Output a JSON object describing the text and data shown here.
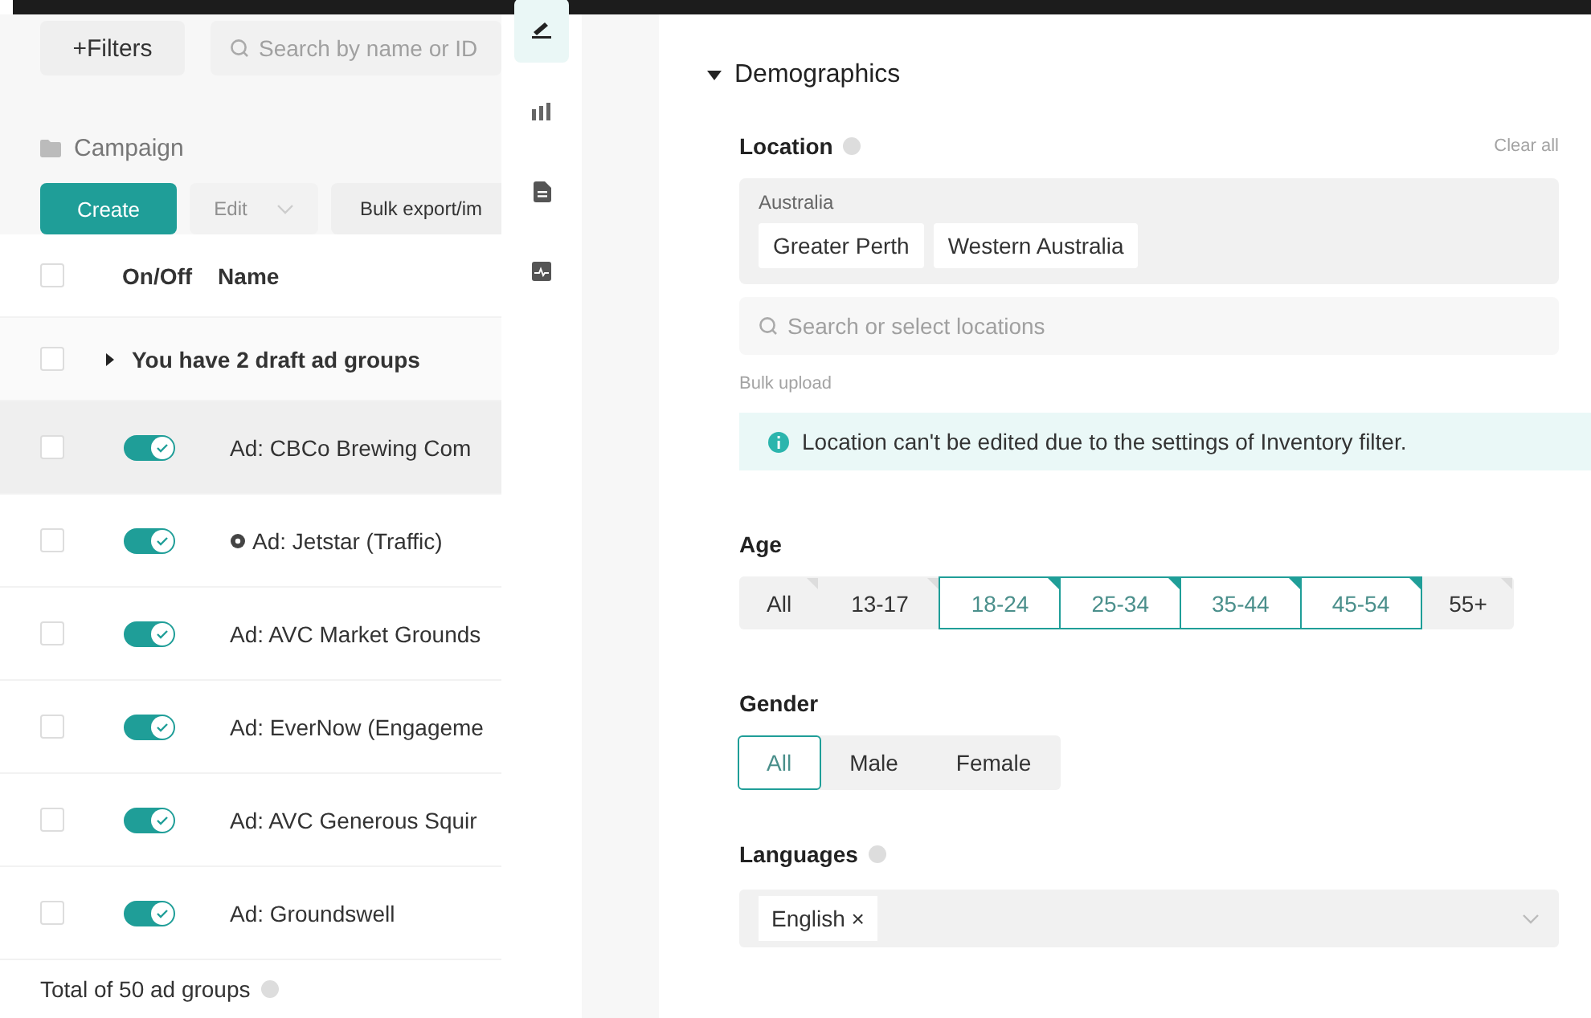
{
  "left_panel": {
    "filters_button": "+Filters",
    "search": {
      "placeholder": "Search by name or ID"
    },
    "breadcrumb": "Campaign",
    "toolbar": {
      "create": "Create",
      "edit": {
        "label": "Edit",
        "disabled": true
      },
      "bulk": "Bulk export/im"
    },
    "table": {
      "columns": [
        "On/Off",
        "Name"
      ],
      "header_checked": false,
      "draft_row": {
        "label": "You have 2 draft ad groups",
        "expanded": false,
        "checked": false
      },
      "rows": [
        {
          "name": "Ad: CBCo Brewing Com",
          "on": true,
          "checked": false,
          "highlighted": true,
          "badge": false
        },
        {
          "name": "Ad: Jetstar (Traffic)",
          "on": true,
          "checked": false,
          "highlighted": false,
          "badge": true
        },
        {
          "name": "Ad: AVC Market Grounds",
          "on": true,
          "checked": false,
          "highlighted": false,
          "badge": false
        },
        {
          "name": "Ad: EverNow (Engageme",
          "on": true,
          "checked": false,
          "highlighted": false,
          "badge": false
        },
        {
          "name": "Ad: AVC Generous Squir",
          "on": true,
          "checked": false,
          "highlighted": false,
          "badge": false
        },
        {
          "name": "Ad: Groundswell",
          "on": true,
          "checked": false,
          "highlighted": false,
          "badge": false
        }
      ]
    },
    "footer": "Total of 50 ad groups"
  },
  "rail": [
    {
      "kind": "pencil",
      "selected": true
    },
    {
      "kind": "chart",
      "selected": false
    },
    {
      "kind": "document",
      "selected": false
    },
    {
      "kind": "image",
      "selected": false
    }
  ],
  "demographics": {
    "title": "Demographics",
    "expanded": true,
    "location": {
      "label": "Location",
      "clear": "Clear all",
      "country": "Australia",
      "tags": [
        "Greater Perth",
        "Western Australia"
      ],
      "search": {
        "placeholder": "Search or select locations"
      },
      "bulk_upload": "Bulk upload",
      "notice": "Location can't be edited due to the settings of Inventory filter."
    },
    "age": {
      "label": "Age",
      "options": [
        {
          "label": "All",
          "selected": false
        },
        {
          "label": "13-17",
          "selected": false
        },
        {
          "label": "18-24",
          "selected": true
        },
        {
          "label": "25-34",
          "selected": true
        },
        {
          "label": "35-44",
          "selected": true
        },
        {
          "label": "45-54",
          "selected": true
        },
        {
          "label": "55+",
          "selected": false
        }
      ]
    },
    "gender": {
      "label": "Gender",
      "options": [
        {
          "label": "All",
          "selected": true
        },
        {
          "label": "Male",
          "selected": false
        },
        {
          "label": "Female",
          "selected": false
        }
      ]
    },
    "languages": {
      "label": "Languages",
      "tags": [
        "English ×"
      ]
    }
  }
}
